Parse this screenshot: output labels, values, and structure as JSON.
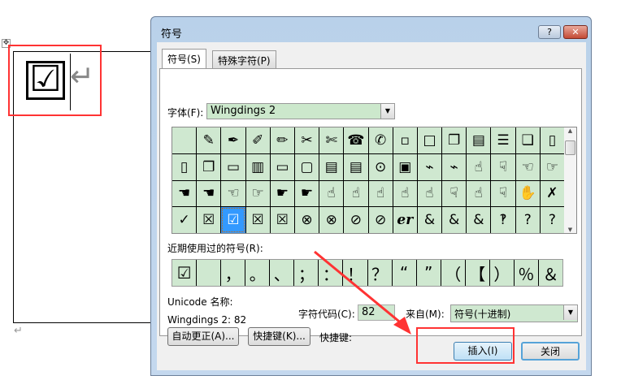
{
  "document": {
    "checkbox_symbol": "☑",
    "move_handle": "✥",
    "enter_arrow": "↵",
    "para_mark": "↵"
  },
  "dialog": {
    "title": "符号",
    "help": "?",
    "close": "✕",
    "tabs": [
      {
        "label": "符号(S)"
      },
      {
        "label": "特殊字符(P)"
      }
    ],
    "font_label": "字体(F):",
    "font_value": "Wingdings 2",
    "grid": [
      "",
      "✎",
      "✒",
      "✐",
      "✏",
      "✂",
      "✄",
      "☎",
      "✆",
      "▫",
      "□",
      "❐",
      "▤",
      "☰",
      "❏",
      "▯",
      "▯",
      "❐",
      "▭",
      "▥",
      "▭",
      "▢",
      "▤",
      "▤",
      "⊙",
      "▣",
      "⌁",
      "⌁",
      "☝",
      "☟",
      "☜",
      "☞",
      "☚",
      "☚",
      "☜",
      "☞",
      "☛",
      "☛",
      "☝",
      "☝",
      "☝",
      "☝",
      "☝",
      "☟",
      "☝",
      "☟",
      "✋",
      "✗",
      "✓",
      "☒",
      "☑",
      "☒",
      "☒",
      "⊗",
      "⊗",
      "⊘",
      "⊘",
      "er",
      "&",
      "&",
      "&",
      "‽",
      "?",
      "?"
    ],
    "selected_index": 50,
    "recent_label": "近期使用过的符号(R):",
    "recent": [
      "☑",
      "",
      "，",
      "。",
      "、",
      "；",
      "：",
      "！",
      "？",
      "“",
      "”",
      "（",
      "【",
      "）",
      "％",
      "＆"
    ],
    "unicode_name_label": "Unicode 名称:",
    "char_name": "Wingdings 2: 82",
    "code_label": "字符代码(C):",
    "code_value": "82",
    "from_label": "来自(M):",
    "from_value": "符号(十进制)",
    "autocorrect_btn": "自动更正(A)...",
    "shortcut_btn": "快捷键(K)...",
    "shortcut_label": "快捷键:",
    "insert_btn": "插入(I)",
    "close_btn": "关闭"
  },
  "colors": {
    "annotation": "#ff3333",
    "cell_bg": "#cfe8d0",
    "selection": "#3399ff"
  }
}
